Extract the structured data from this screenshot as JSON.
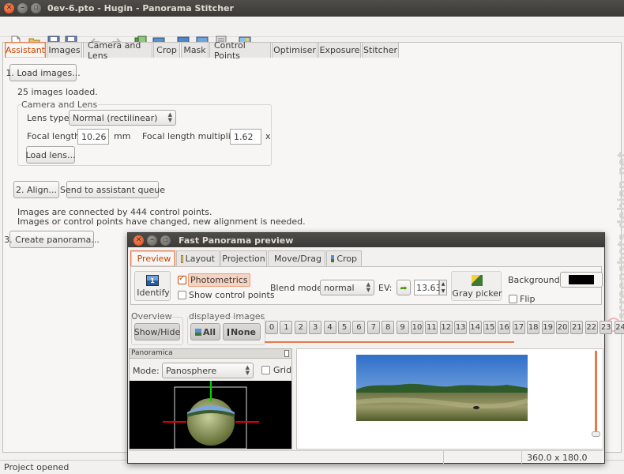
{
  "window": {
    "title": "0ev-6.pto - Hugin - Panorama Stitcher"
  },
  "tabs": [
    "Assistant",
    "Images",
    "Camera and Lens",
    "Crop",
    "Mask",
    "Control Points",
    "Optimiser",
    "Exposure",
    "Stitcher"
  ],
  "assistant": {
    "load_images": "1. Load images...",
    "images_loaded": "25 images loaded.",
    "group_title": "Camera and Lens",
    "lens_type_label": "Lens type:",
    "lens_type_value": "Normal (rectilinear)",
    "focal_length_label": "Focal length:",
    "focal_length_value": "10.26",
    "focal_unit": "mm",
    "multiplier_label": "Focal length multiplier:",
    "multiplier_value": "1.62",
    "multiplier_unit": "x",
    "load_lens": "Load lens...",
    "align": "2. Align...",
    "send_queue": "Send to assistant queue",
    "status_line1": "Images are connected by 444 control points.",
    "status_line2": "Images or control points have changed, new alignment is needed.",
    "create_panorama": "3. Create panorama..."
  },
  "statusbar": {
    "text": "Project opened"
  },
  "watermark": "screenshots.debian.net",
  "preview": {
    "title": "Fast Panorama preview",
    "tabs": [
      "Preview",
      "Layout",
      "Projection",
      "Move/Drag",
      "Crop"
    ],
    "identify": "Identify",
    "photometrics": "Photometrics",
    "show_cp": "Show control points",
    "blend_mode_label": "Blend mode:",
    "blend_mode_value": "normal",
    "ev_label": "EV:",
    "ev_value": "13.63",
    "gray_picker": "Gray picker",
    "background_label": "Background:",
    "background_color": "#000000",
    "flip": "Flip",
    "overview_label": "Overview",
    "show_hide": "Show/Hide",
    "displayed_images_label": "displayed images",
    "all": "All",
    "none": "None",
    "image_numbers": [
      "0",
      "1",
      "2",
      "3",
      "4",
      "5",
      "6",
      "7",
      "8",
      "9",
      "10",
      "11",
      "12",
      "13",
      "14",
      "15",
      "16",
      "17",
      "18",
      "19",
      "20",
      "21",
      "22",
      "23",
      "24"
    ],
    "panoramica_title": "Panoramica",
    "mode_label": "Mode:",
    "mode_value": "Panosphere",
    "grid": "Grid",
    "fov": "360.0 x 180.0"
  }
}
